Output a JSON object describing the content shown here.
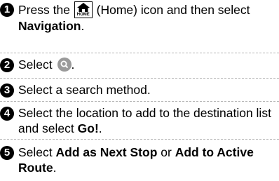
{
  "steps": [
    {
      "num": "1",
      "t1": "Press the ",
      "icon": "home-icon",
      "icon_caption": "HOME",
      "t2": " (Home) icon and then select ",
      "b1": "Navigation",
      "t3": "."
    },
    {
      "num": "2",
      "t1": "Select ",
      "icon": "search-icon",
      "t2": "."
    },
    {
      "num": "3",
      "t1": "Select a search method."
    },
    {
      "num": "4",
      "t1": "Select the location to add to the destination list and select ",
      "b1": "Go!",
      "t2": "."
    },
    {
      "num": "5",
      "t1": "Select ",
      "b1": "Add as Next Stop",
      "t2": " or ",
      "b2": "Add to Active Route",
      "t3": "."
    }
  ]
}
